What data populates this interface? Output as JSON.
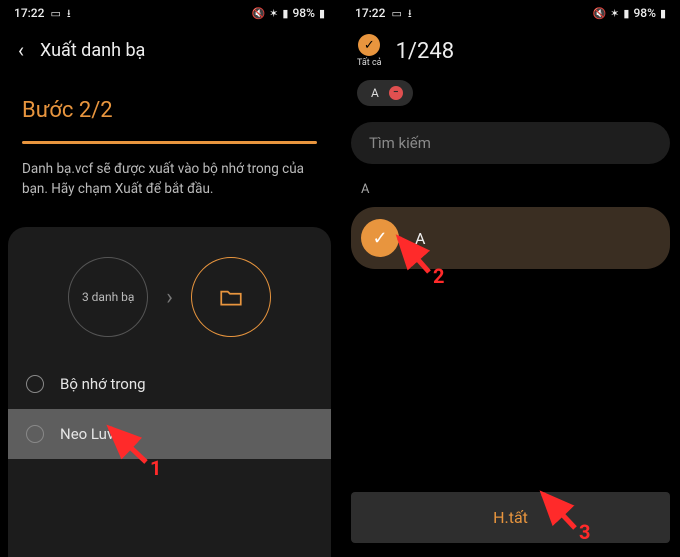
{
  "status": {
    "time": "17:22",
    "battery": "98%"
  },
  "left": {
    "header_title": "Xuất danh bạ",
    "step": "Bước 2/2",
    "description": "Danh bạ.vcf sẽ được xuất vào bộ nhớ trong của bạn. Hãy chạm Xuất để bắt đầu.",
    "contacts_count_label": "3 danh bạ",
    "options": [
      {
        "label": "Bộ nhớ trong",
        "selected": false
      },
      {
        "label": "Neo Luvis",
        "selected": true
      }
    ]
  },
  "right": {
    "select_all_label": "Tất cả",
    "counter": "1/248",
    "chip_letter": "A",
    "search_placeholder": "Tìm kiếm",
    "section": "A",
    "contact_name": "A",
    "action_label": "H.tất"
  },
  "annotations": {
    "a1": "1",
    "a2": "2",
    "a3": "3"
  }
}
